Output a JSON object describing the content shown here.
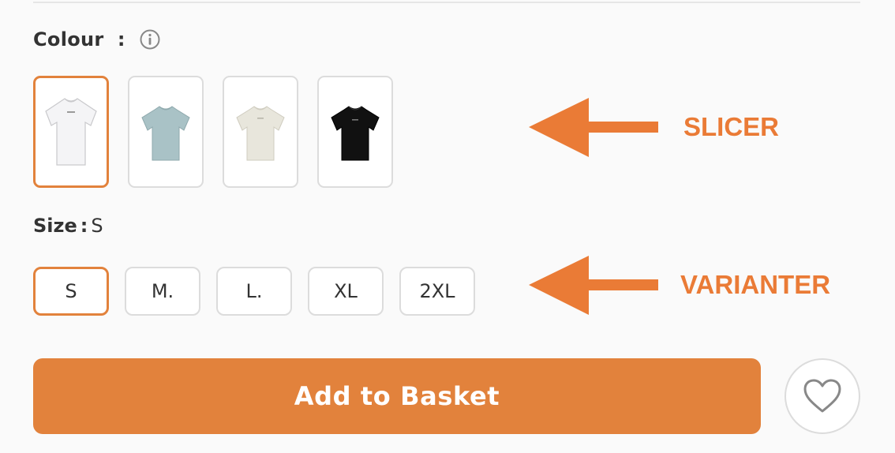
{
  "colour": {
    "label": "Colour",
    "separator": ":",
    "info_icon": "info-icon",
    "swatches": [
      {
        "name": "white",
        "color": "#f4f4f6",
        "selected": true
      },
      {
        "name": "light-blue",
        "color": "#a9c2c6",
        "selected": false
      },
      {
        "name": "off-white",
        "color": "#e8e6dc",
        "selected": false
      },
      {
        "name": "black",
        "color": "#111111",
        "selected": false
      }
    ]
  },
  "size": {
    "label": "Size",
    "separator": ":",
    "current": "S",
    "options": [
      {
        "label": "S",
        "selected": true
      },
      {
        "label": "M.",
        "selected": false
      },
      {
        "label": "L.",
        "selected": false
      },
      {
        "label": "XL",
        "selected": false
      },
      {
        "label": "2XL",
        "selected": false
      }
    ]
  },
  "annotations": {
    "slicer": "SLICER",
    "varianter": "VARIANTER",
    "accent": "#ea7b36"
  },
  "actions": {
    "add_to_basket": "Add to Basket",
    "wishlist_icon": "heart-icon"
  },
  "colors": {
    "accent": "#e2823c",
    "border": "#dcdcdc"
  }
}
